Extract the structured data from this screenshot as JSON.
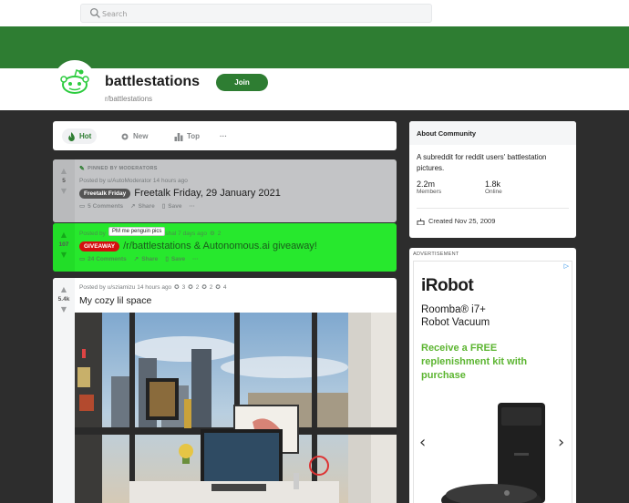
{
  "search": {
    "placeholder": "Search"
  },
  "subreddit": {
    "title": "battlestations",
    "name": "r/battlestations",
    "join_label": "Join",
    "banner_color": "#2e7d32"
  },
  "sortbar": {
    "items": [
      {
        "label": "Hot",
        "active": true
      },
      {
        "label": "New"
      },
      {
        "label": "Top"
      },
      {
        "label": "···"
      }
    ]
  },
  "posts": [
    {
      "pinned_label": "PINNED BY MODERATORS",
      "votes": "5",
      "meta": "Posted by u/AutoModerator 14 hours ago",
      "flair": "Freetalk Friday",
      "title": "Freetalk Friday, 29 January 2021",
      "comments": "5 Comments",
      "share": "Share",
      "save": "Save",
      "more": "···"
    },
    {
      "votes": "107",
      "meta_prefix": "Posted by",
      "meta_suffix": "u/Hareshal 7 days ago",
      "award_count": "2",
      "tooltip": "PM me penguin pics",
      "flair": "GIVEAWAY",
      "title": "/r/battlestations & Autonomous.ai giveaway!",
      "comments": "24 Comments",
      "share": "Share",
      "save": "Save",
      "more": "···"
    },
    {
      "votes": "5.4k",
      "meta": "Posted by u/sziamizu 14 hours ago",
      "awards": [
        "3",
        "2",
        "2",
        "4"
      ],
      "title": "My cozy lil space"
    }
  ],
  "about": {
    "heading": "About Community",
    "description": "A subreddit for reddit users' battlestation pictures.",
    "members_value": "2.2m",
    "members_label": "Members",
    "online_value": "1.8k",
    "online_label": "Online",
    "created": "Created Nov 25, 2009"
  },
  "ad": {
    "label": "ADVERTISEMENT",
    "logo": "iRobot",
    "product_line1": "Roomba® i7+",
    "product_line2": "Robot Vacuum",
    "offer": "Receive a FREE replenishment kit with purchase",
    "prev": "‹",
    "next": "›"
  }
}
